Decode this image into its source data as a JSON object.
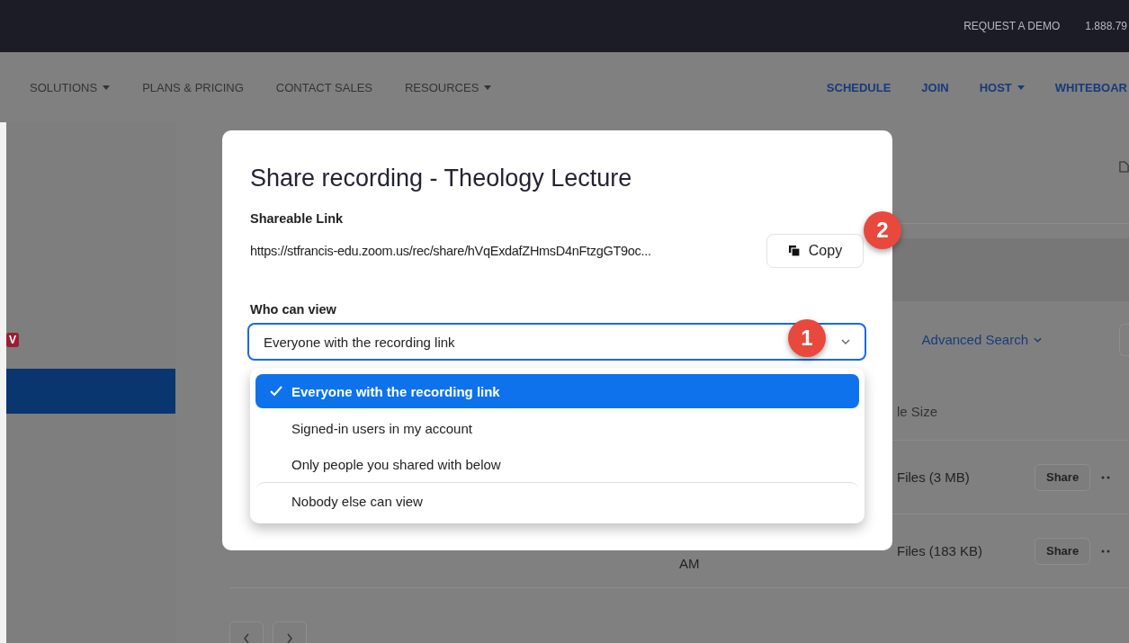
{
  "top_bar": {
    "links": [
      "REQUEST A DEMO",
      "1.888.79"
    ]
  },
  "nav": {
    "left": [
      {
        "label": "SOLUTIONS",
        "dropdown": true
      },
      {
        "label": "PLANS & PRICING",
        "dropdown": false
      },
      {
        "label": "CONTACT SALES",
        "dropdown": false
      },
      {
        "label": "RESOURCES",
        "dropdown": true
      }
    ],
    "right": [
      {
        "label": "SCHEDULE",
        "dropdown": false
      },
      {
        "label": "JOIN",
        "dropdown": false
      },
      {
        "label": "HOST",
        "dropdown": true
      },
      {
        "label": "WHITEBOAR",
        "dropdown": false
      }
    ]
  },
  "sidebar": {
    "badge": "V",
    "items": [
      {
        "selected": true
      }
    ]
  },
  "search": {
    "advanced_search": "Advanced Search"
  },
  "table": {
    "columns": [
      "le Size"
    ],
    "rows": [
      {
        "file_size": "Files (3 MB)",
        "action": "Share"
      },
      {
        "start_time": "AM",
        "file_size": "Files (183 KB)",
        "action": "Share"
      }
    ]
  },
  "modal": {
    "title": "Share recording - Theology Lecture",
    "link_label": "Shareable Link",
    "link": "https://stfrancis-edu.zoom.us/rec/share/hVqExdafZHmsD4nFtzgGT9oc...",
    "copy_button": "Copy",
    "view_label": "Who can view",
    "select_value": "Everyone with the recording link",
    "options": [
      {
        "label": "Everyone with the recording link",
        "selected": true,
        "divider_before": false
      },
      {
        "label": "Signed-in users in my account",
        "selected": false,
        "divider_before": false
      },
      {
        "label": "Only people you shared with below",
        "selected": false,
        "divider_before": false
      },
      {
        "label": "Nobody else can view",
        "selected": false,
        "divider_before": true
      }
    ]
  },
  "callouts": [
    {
      "number": "1"
    },
    {
      "number": "2"
    }
  ]
}
